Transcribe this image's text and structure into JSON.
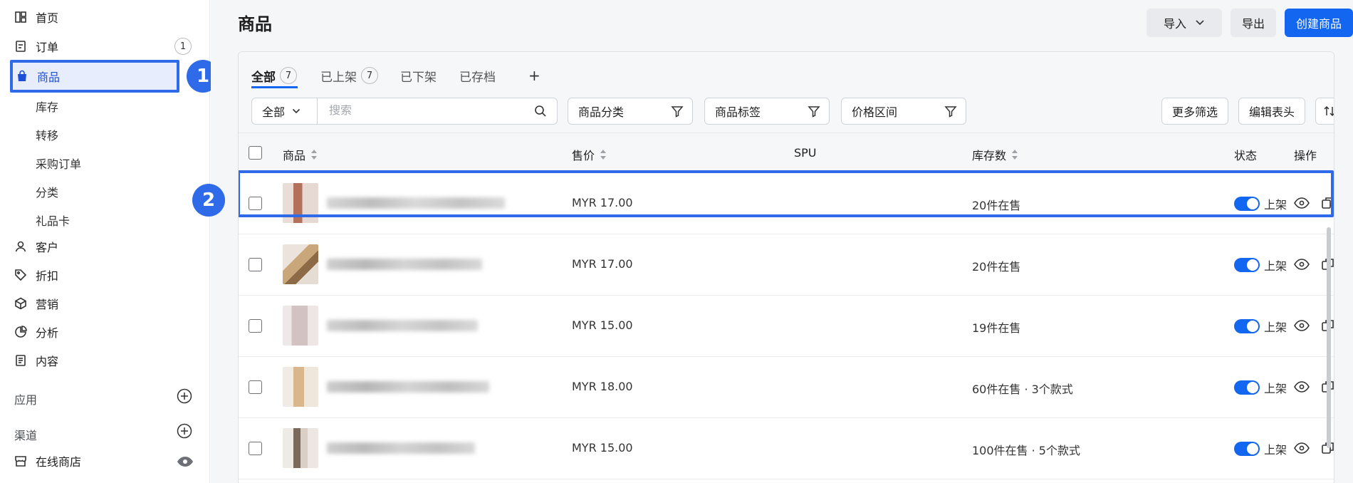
{
  "sidebar": {
    "home": "首页",
    "orders": "订单",
    "orders_count": "1",
    "products": "商品",
    "sub_items": [
      "库存",
      "转移",
      "采购订单",
      "分类",
      "礼品卡"
    ],
    "customers": "客户",
    "discounts": "折扣",
    "marketing": "营销",
    "analytics": "分析",
    "content": "内容",
    "apps_label": "应用",
    "channels_label": "渠道",
    "online_store": "在线商店"
  },
  "callouts": [
    "1",
    "2"
  ],
  "header": {
    "title": "商品",
    "import_label": "导入",
    "export_label": "导出",
    "create_label": "创建商品"
  },
  "tabs": [
    {
      "label": "全部",
      "count": "7"
    },
    {
      "label": "已上架",
      "count": "7"
    },
    {
      "label": "已下架"
    },
    {
      "label": "已存档"
    },
    {
      "label": "+"
    }
  ],
  "filters": {
    "scope": "全部",
    "search_placeholder": "搜索",
    "category": "商品分类",
    "tags": "商品标签",
    "price_range": "价格区间",
    "more_filters": "更多筛选",
    "edit_columns": "编辑表头"
  },
  "table": {
    "columns": {
      "product": "商品",
      "price": "售价",
      "spu": "SPU",
      "stock": "库存数",
      "status": "状态",
      "actions": "操作"
    },
    "rows": [
      {
        "price": "MYR 17.00",
        "stock": "20件在售",
        "status": "上架"
      },
      {
        "price": "MYR 17.00",
        "stock": "20件在售",
        "status": "上架"
      },
      {
        "price": "MYR 15.00",
        "stock": "19件在售",
        "status": "上架"
      },
      {
        "price": "MYR 18.00",
        "stock": "60件在售 · 3个款式",
        "status": "上架"
      },
      {
        "price": "MYR 15.00",
        "stock": "100件在售 · 5个款式",
        "status": "上架"
      }
    ]
  },
  "colors": {
    "accent": "#1366f0",
    "highlight": "#2f6ae8"
  }
}
